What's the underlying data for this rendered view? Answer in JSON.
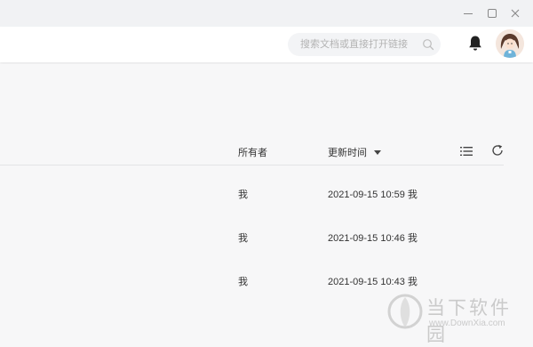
{
  "window": {
    "controls": [
      "minimize-icon",
      "maximize-icon",
      "close-icon"
    ]
  },
  "header": {
    "search": {
      "placeholder": "搜索文档或直接打开链接",
      "value": ""
    },
    "icons": [
      "search-icon",
      "bell-icon",
      "avatar"
    ]
  },
  "list": {
    "columns": {
      "owner": "所有者",
      "updated": "更新时间"
    },
    "sort_indicator": "caret-down-icon",
    "tool_icons": [
      "list-view-icon",
      "refresh-icon"
    ],
    "rows": [
      {
        "owner": "我",
        "time": "2021-09-15 10:59 我"
      },
      {
        "owner": "我",
        "time": "2021-09-15 10:46 我"
      },
      {
        "owner": "我",
        "time": "2021-09-15 10:43 我"
      }
    ]
  },
  "watermark": {
    "title": "当下软件园",
    "subtitle": "www.DownXia.com"
  }
}
